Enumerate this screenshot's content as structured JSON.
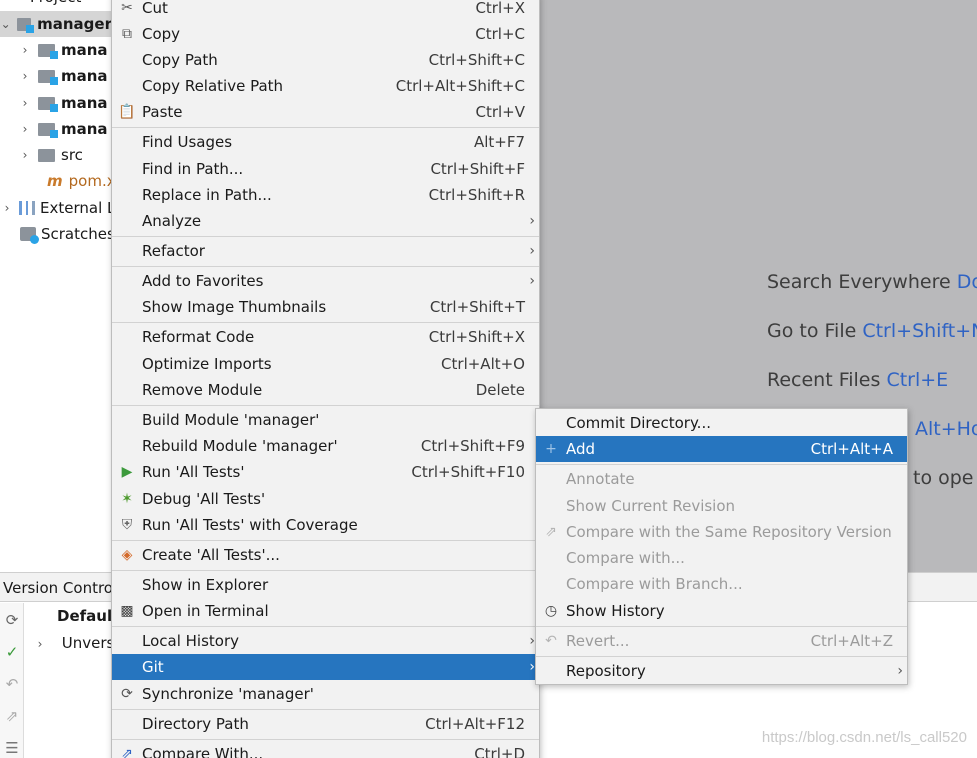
{
  "project": {
    "header_label": "Project",
    "root": "manager",
    "children": [
      "mana",
      "mana",
      "mana",
      "mana",
      "src"
    ],
    "pom": "pom.x",
    "external": "External L",
    "scratches": "Scratches"
  },
  "editor": {
    "hints": [
      {
        "label": "Search Everywhere ",
        "key": "Do"
      },
      {
        "label": "Go to File ",
        "key": "Ctrl+Shift+N"
      },
      {
        "label": "Recent Files ",
        "key": "Ctrl+E"
      },
      {
        "label": "",
        "key": "Alt+Ho"
      },
      {
        "label": "to ope",
        "key": ""
      }
    ]
  },
  "vc": {
    "title": "Version Contro",
    "rows": [
      "Defaul",
      "Unversi"
    ]
  },
  "main_menu": {
    "items": [
      {
        "label": "Cut",
        "shortcut": "Ctrl+X"
      },
      {
        "label": "Copy",
        "shortcut": "Ctrl+C"
      },
      {
        "label": "Copy Path",
        "shortcut": "Ctrl+Shift+C"
      },
      {
        "label": "Copy Relative Path",
        "shortcut": "Ctrl+Alt+Shift+C"
      },
      {
        "label": "Paste",
        "shortcut": "Ctrl+V"
      },
      {
        "label": "Find Usages",
        "shortcut": "Alt+F7"
      },
      {
        "label": "Find in Path...",
        "shortcut": "Ctrl+Shift+F"
      },
      {
        "label": "Replace in Path...",
        "shortcut": "Ctrl+Shift+R"
      },
      {
        "label": "Analyze",
        "shortcut": ""
      },
      {
        "label": "Refactor",
        "shortcut": ""
      },
      {
        "label": "Add to Favorites",
        "shortcut": ""
      },
      {
        "label": "Show Image Thumbnails",
        "shortcut": "Ctrl+Shift+T"
      },
      {
        "label": "Reformat Code",
        "shortcut": "Ctrl+Shift+X"
      },
      {
        "label": "Optimize Imports",
        "shortcut": "Ctrl+Alt+O"
      },
      {
        "label": "Remove Module",
        "shortcut": "Delete"
      },
      {
        "label": "Build Module 'manager'",
        "shortcut": ""
      },
      {
        "label": "Rebuild Module 'manager'",
        "shortcut": "Ctrl+Shift+F9"
      },
      {
        "label": "Run 'All Tests'",
        "shortcut": "Ctrl+Shift+F10"
      },
      {
        "label": "Debug 'All Tests'",
        "shortcut": ""
      },
      {
        "label": "Run 'All Tests' with Coverage",
        "shortcut": ""
      },
      {
        "label": "Create 'All Tests'...",
        "shortcut": ""
      },
      {
        "label": "Show in Explorer",
        "shortcut": ""
      },
      {
        "label": "Open in Terminal",
        "shortcut": ""
      },
      {
        "label": "Local History",
        "shortcut": ""
      },
      {
        "label": "Git",
        "shortcut": ""
      },
      {
        "label": "Synchronize 'manager'",
        "shortcut": ""
      },
      {
        "label": "Directory Path",
        "shortcut": "Ctrl+Alt+F12"
      },
      {
        "label": "Compare With...",
        "shortcut": "Ctrl+D"
      }
    ]
  },
  "git_menu": {
    "items": [
      {
        "label": "Commit Directory...",
        "shortcut": ""
      },
      {
        "label": "Add",
        "shortcut": "Ctrl+Alt+A"
      },
      {
        "label": "Annotate",
        "shortcut": ""
      },
      {
        "label": "Show Current Revision",
        "shortcut": ""
      },
      {
        "label": "Compare with the Same Repository Version",
        "shortcut": ""
      },
      {
        "label": "Compare with...",
        "shortcut": ""
      },
      {
        "label": "Compare with Branch...",
        "shortcut": ""
      },
      {
        "label": "Show History",
        "shortcut": ""
      },
      {
        "label": "Revert...",
        "shortcut": "Ctrl+Alt+Z"
      },
      {
        "label": "Repository",
        "shortcut": ""
      }
    ]
  },
  "watermark": "https://blog.csdn.net/ls_call520",
  "colors": {
    "selection": "#2675bf",
    "editor_bg": "#b9b9bb",
    "shortcut_blue": "#2f63c4"
  }
}
